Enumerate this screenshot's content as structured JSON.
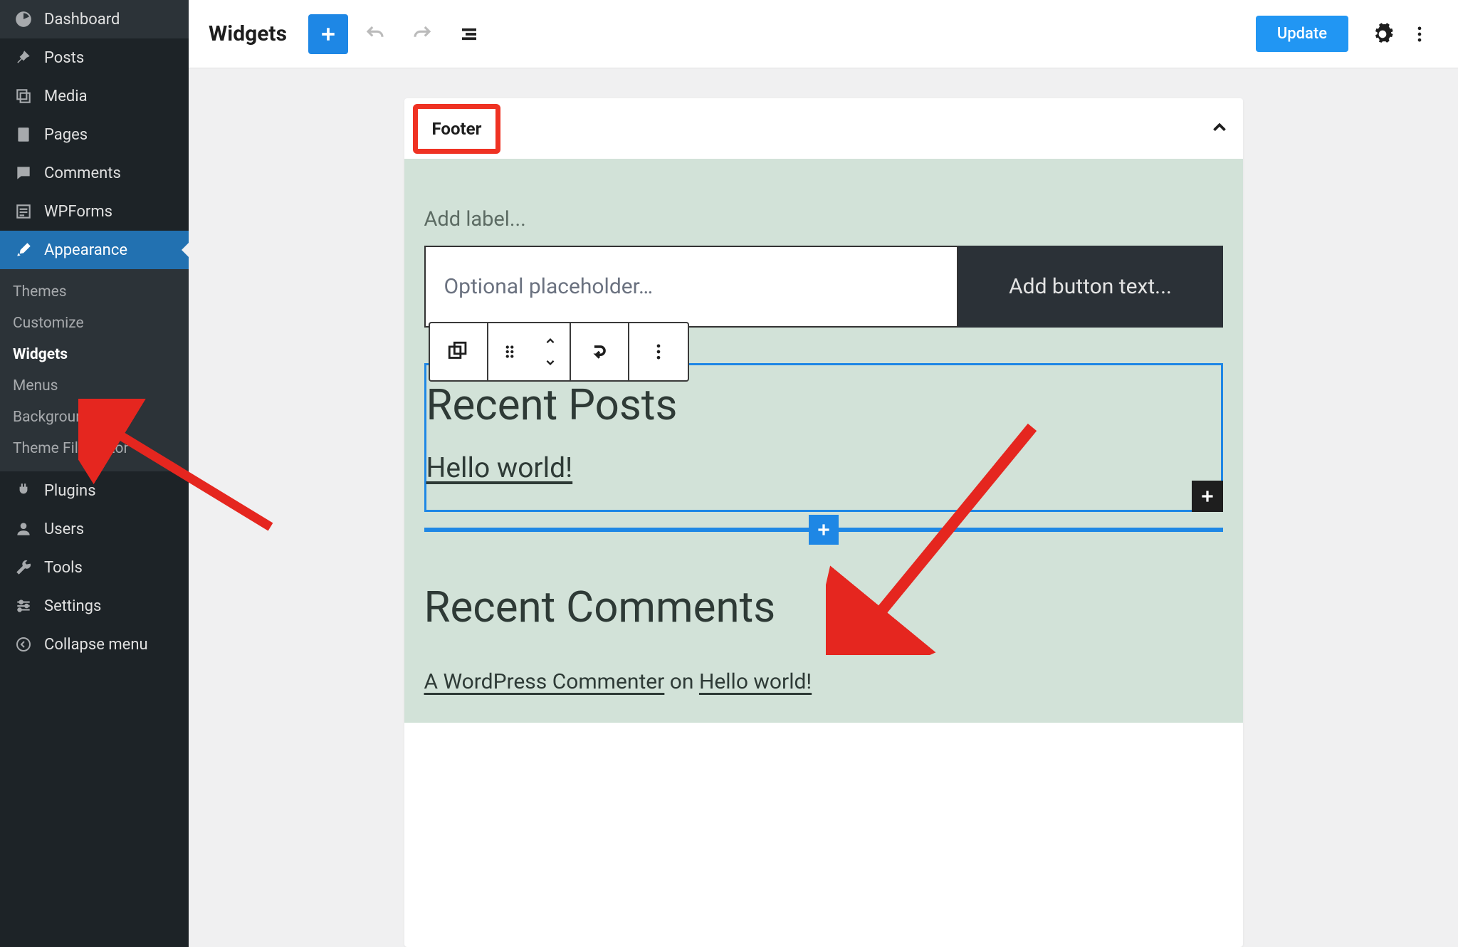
{
  "sidebar": {
    "items": [
      {
        "icon": "dashboard",
        "label": "Dashboard"
      },
      {
        "icon": "pin",
        "label": "Posts"
      },
      {
        "icon": "media",
        "label": "Media"
      },
      {
        "icon": "page",
        "label": "Pages"
      },
      {
        "icon": "comment",
        "label": "Comments"
      },
      {
        "icon": "form",
        "label": "WPForms"
      },
      {
        "icon": "brush",
        "label": "Appearance"
      },
      {
        "icon": "plug",
        "label": "Plugins"
      },
      {
        "icon": "user",
        "label": "Users"
      },
      {
        "icon": "wrench",
        "label": "Tools"
      },
      {
        "icon": "sliders",
        "label": "Settings"
      },
      {
        "icon": "collapse",
        "label": "Collapse menu"
      }
    ],
    "submenu": [
      "Themes",
      "Customize",
      "Widgets",
      "Menus",
      "Background",
      "Theme File Editor"
    ],
    "active_submenu": "Widgets"
  },
  "topbar": {
    "title": "Widgets",
    "update_label": "Update"
  },
  "footer_panel": {
    "title": "Footer",
    "add_label_placeholder": "Add label...",
    "search_placeholder": "Optional placeholder…",
    "button_placeholder": "Add button text..."
  },
  "recent_posts": {
    "heading": "Recent Posts",
    "posts": [
      "Hello world!"
    ]
  },
  "recent_comments": {
    "heading": "Recent Comments",
    "items": [
      {
        "author": "A WordPress Commenter",
        "connector": "on",
        "post": "Hello world!"
      }
    ]
  }
}
